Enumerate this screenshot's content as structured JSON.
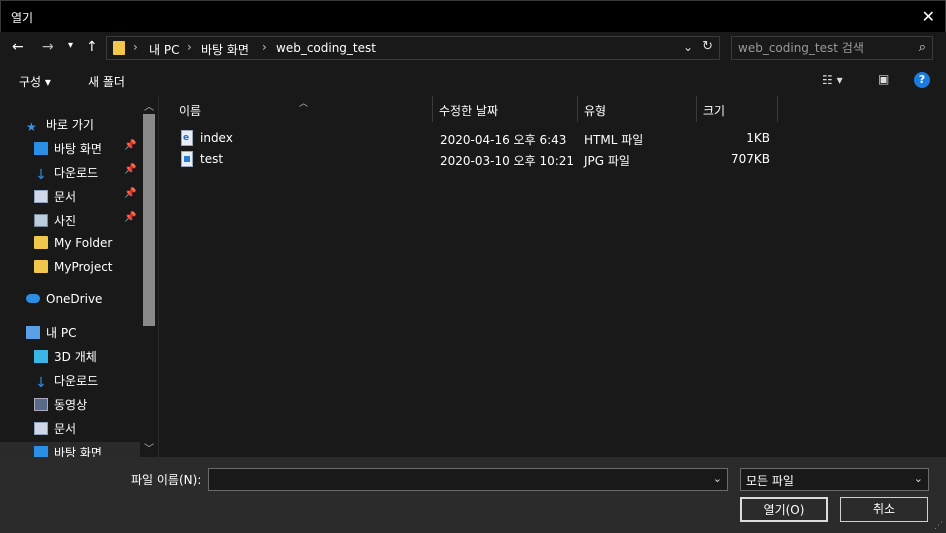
{
  "window": {
    "title": "열기",
    "close": "✕"
  },
  "address": {
    "crumbs": [
      "내 PC",
      "바탕 화면",
      "web_coding_test"
    ]
  },
  "search": {
    "placeholder": "web_coding_test 검색"
  },
  "toolbar": {
    "organize": "구성 ▾",
    "new_folder": "새 폴더",
    "help": "?"
  },
  "nav": {
    "quick_access": "바로 가기",
    "items": [
      {
        "label": "바탕 화면",
        "pinned": true
      },
      {
        "label": "다운로드",
        "pinned": true
      },
      {
        "label": "문서",
        "pinned": true
      },
      {
        "label": "사진",
        "pinned": true
      },
      {
        "label": "My Folder",
        "pinned": false
      },
      {
        "label": "MyProject",
        "pinned": false
      }
    ],
    "onedrive": "OneDrive",
    "this_pc": "내 PC",
    "pc_items": [
      "3D 개체",
      "다운로드",
      "동영상",
      "문서",
      "바탕 화면"
    ]
  },
  "columns": {
    "name": "이름",
    "date": "수정한 날짜",
    "type": "유형",
    "size": "크기"
  },
  "files": [
    {
      "name": "index",
      "date": "2020-04-16 오후 6:43",
      "type": "HTML 파일",
      "size": "1KB",
      "icon": "html-file-icon"
    },
    {
      "name": "test",
      "date": "2020-03-10 오후 10:21",
      "type": "JPG 파일",
      "size": "707KB",
      "icon": "jpg-file-icon"
    }
  ],
  "bottom": {
    "filename_label": "파일 이름(N):",
    "filename_value": "",
    "filetype_value": "모든 파일",
    "open_label": "열기(O)",
    "cancel_label": "취소"
  },
  "colors": {
    "accent": "#1a7ce0",
    "folder": "#f1c84c"
  }
}
